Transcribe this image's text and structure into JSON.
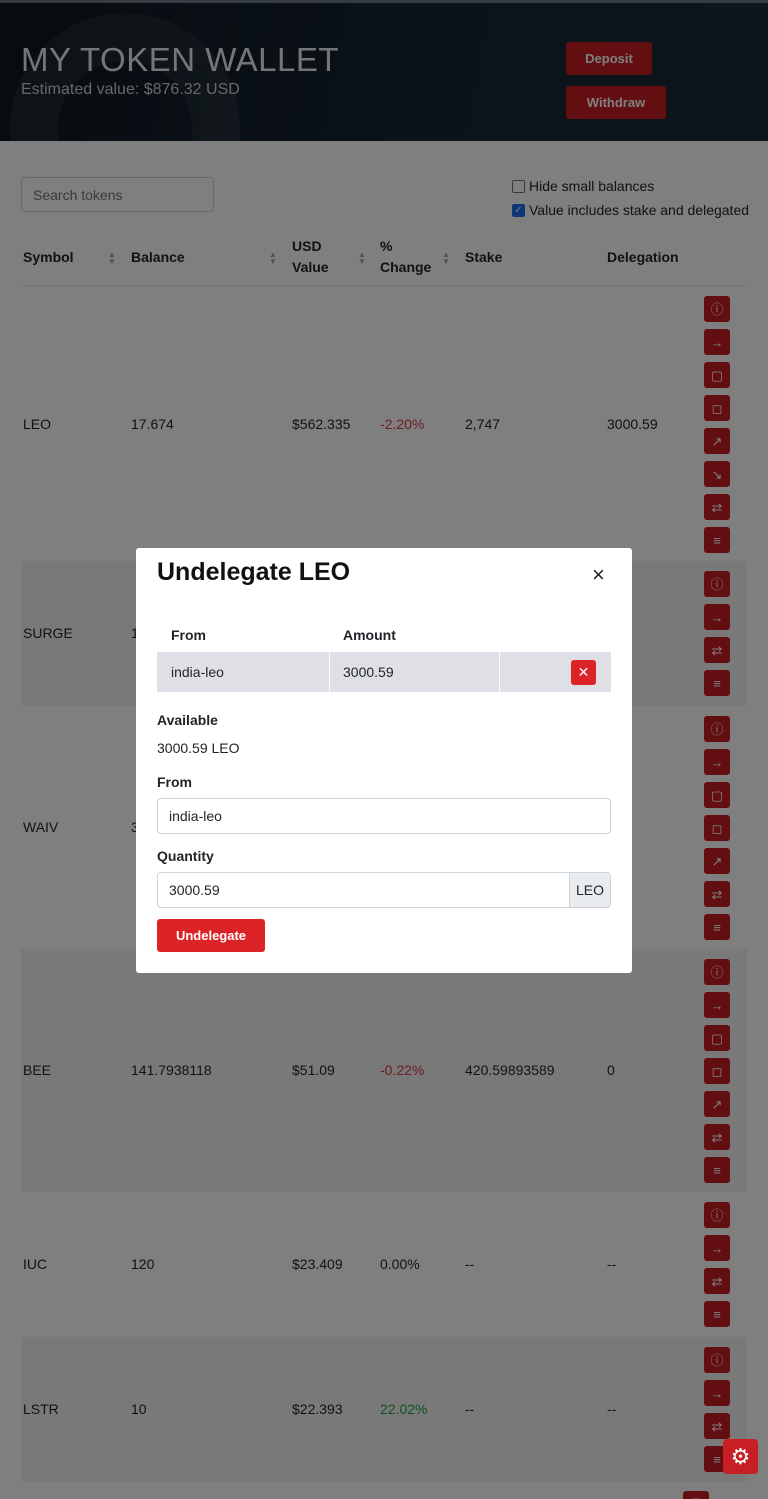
{
  "header": {
    "title": "MY TOKEN WALLET",
    "estimated_value": "Estimated value: $876.32 USD",
    "deposit_label": "Deposit",
    "withdraw_label": "Withdraw"
  },
  "filters": {
    "search_placeholder": "Search tokens",
    "hide_small_label": "Hide small balances",
    "hide_small_checked": false,
    "include_stake_label": "Value includes stake and delegated",
    "include_stake_checked": true
  },
  "table": {
    "headers": {
      "symbol": "Symbol",
      "balance": "Balance",
      "usd_line1": "USD",
      "usd_line2": "Value",
      "change_line1": "%",
      "change_line2": "Change",
      "stake": "Stake",
      "delegation": "Delegation"
    },
    "rows": [
      {
        "symbol": "LEO",
        "balance": "17.674",
        "usd": "$562.335",
        "change": "-2.20%",
        "stake": "2,747",
        "delegation": "3000.59"
      },
      {
        "symbol": "SURGE",
        "balance": "1",
        "usd": "",
        "change": "",
        "stake": "",
        "delegation": ""
      },
      {
        "symbol": "WAIV",
        "balance": "3",
        "usd": "",
        "change": "",
        "stake": "",
        "delegation": ""
      },
      {
        "symbol": "BEE",
        "balance": "141.7938118",
        "usd": "$51.09",
        "change": "-0.22%",
        "stake": "420.59893589",
        "delegation": "0"
      },
      {
        "symbol": "IUC",
        "balance": "120",
        "usd": "$23.409",
        "change": "0.00%",
        "stake": "--",
        "delegation": "--"
      },
      {
        "symbol": "LSTR",
        "balance": "10",
        "usd": "$22.393",
        "change": "22.02%",
        "stake": "--",
        "delegation": "--"
      }
    ]
  },
  "modal": {
    "title": "Undelegate LEO",
    "close_label": "×",
    "col_from": "From",
    "col_amount": "Amount",
    "entry_from": "india-leo",
    "entry_amount": "3000.59",
    "delete_label": "✕",
    "available_label": "Available",
    "available_value": "3000.59 LEO",
    "from_label": "From",
    "from_value": "india-leo",
    "quantity_label": "Quantity",
    "quantity_value": "3000.59",
    "quantity_unit": "LEO",
    "submit_label": "Undelegate"
  },
  "icons": {
    "info": "info-icon",
    "transfer": "arrow-right-icon",
    "stake": "lock-icon",
    "unstake": "unlock-icon",
    "delegate": "trending-up-icon",
    "undelegate": "trending-down-icon",
    "swap": "swap-icon",
    "history": "list-icon",
    "settings": "gear-icon"
  },
  "colors": {
    "accent": "#c71f24",
    "negative": "#dc3545",
    "positive": "#28a745",
    "header_bg": "#15232e"
  }
}
